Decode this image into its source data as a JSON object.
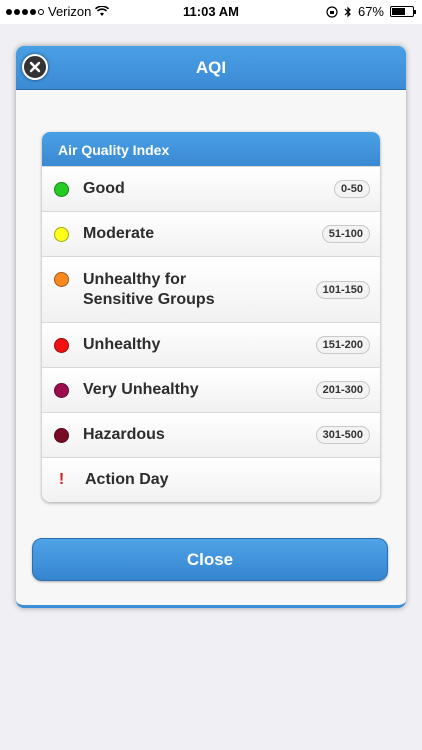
{
  "status_bar": {
    "carrier": "Verizon",
    "time": "11:03 AM",
    "battery": "67%",
    "battery_level": 0.67
  },
  "dialog": {
    "title": "AQI",
    "close_label": "Close"
  },
  "aqi_table": {
    "header": "Air Quality Index",
    "rows": [
      {
        "label": "Good",
        "range": "0-50",
        "color": "#22cc22"
      },
      {
        "label": "Moderate",
        "range": "51-100",
        "color": "#ffff1a"
      },
      {
        "label_line1": "Unhealthy for",
        "label_line2": "Sensitive Groups",
        "range": "101-150",
        "color": "#f7891f"
      },
      {
        "label": "Unhealthy",
        "range": "151-200",
        "color": "#f01010"
      },
      {
        "label": "Very Unhealthy",
        "range": "201-300",
        "color": "#9b0d4f"
      },
      {
        "label": "Hazardous",
        "range": "301-500",
        "color": "#7a0b24"
      },
      {
        "label": "Action Day",
        "marker": "!"
      }
    ]
  },
  "colors": {
    "accent": "#3b8ad5",
    "action_marker": "#d42020"
  }
}
